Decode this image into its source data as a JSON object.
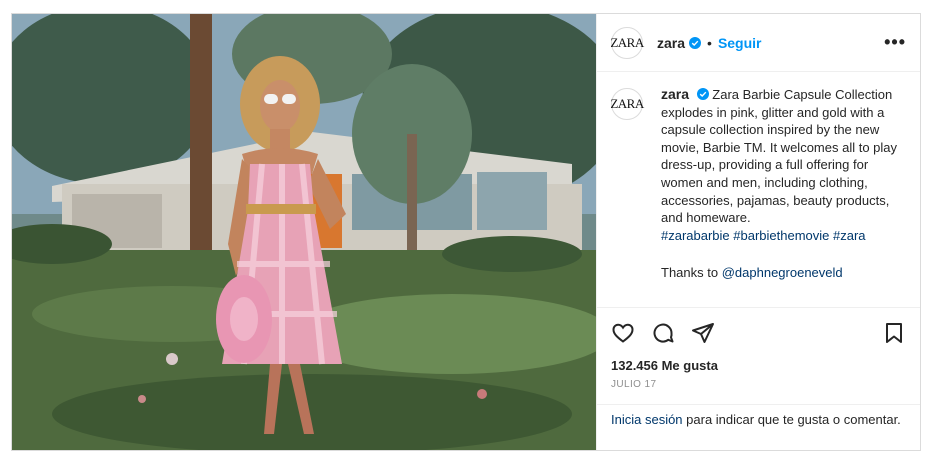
{
  "account": {
    "avatar_text": "ZARA",
    "username": "zara",
    "separator": "•",
    "follow_label": "Seguir",
    "more_label": "•••"
  },
  "caption": {
    "username": "zara",
    "text": "Zara Barbie Capsule Collection explodes in pink, glitter and gold with a capsule collection inspired by the new movie, Barbie TM. It welcomes all to play dress-up, providing a full offering for women and men, including clothing, accessories, pajamas, beauty products, and homeware.",
    "hashtags": "#zarabarbie #barbiethemovie #zara",
    "thanks_prefix": "Thanks to",
    "thanks_mention": "@daphnegroeneveld"
  },
  "actions": {
    "like_icon": "heart-icon",
    "comment_icon": "comment-icon",
    "share_icon": "paper-plane-icon",
    "save_icon": "bookmark-icon"
  },
  "stats": {
    "likes": "132.456 Me gusta",
    "date": "JULIO 17"
  },
  "login_prompt": {
    "link": "Inicia sesión",
    "text": " para indicar que te gusta o comentar."
  },
  "colors": {
    "accent": "#0095f6",
    "link": "#00376b",
    "muted": "#8e8e8e",
    "border": "#dbdbdb"
  }
}
